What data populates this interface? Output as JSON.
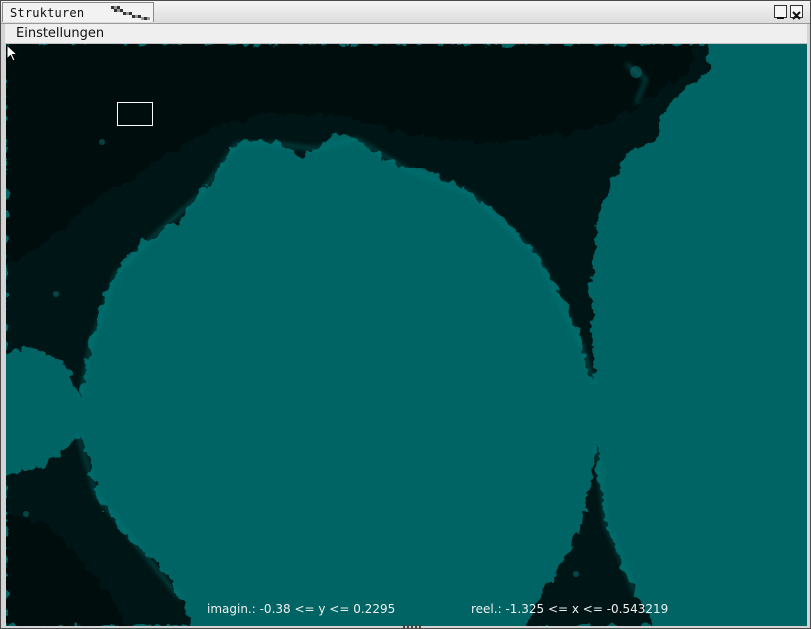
{
  "window": {
    "title": "Strukturen",
    "minimize_icon": "minimize-icon",
    "close_icon": "close-icon"
  },
  "menu": {
    "items": [
      {
        "label": "Einstellungen"
      }
    ]
  },
  "canvas": {
    "fractal": "mandelbrot-set",
    "background_color": "#006464",
    "dark_color": "#001818",
    "selection_box": true,
    "cursor_icon": "arrow-cursor-icon"
  },
  "status": {
    "imaginary_range": "imagin.: -0.38 <= y <= 0.2295",
    "real_range": "reel.: -1.325 <= x <= -0.543219"
  }
}
